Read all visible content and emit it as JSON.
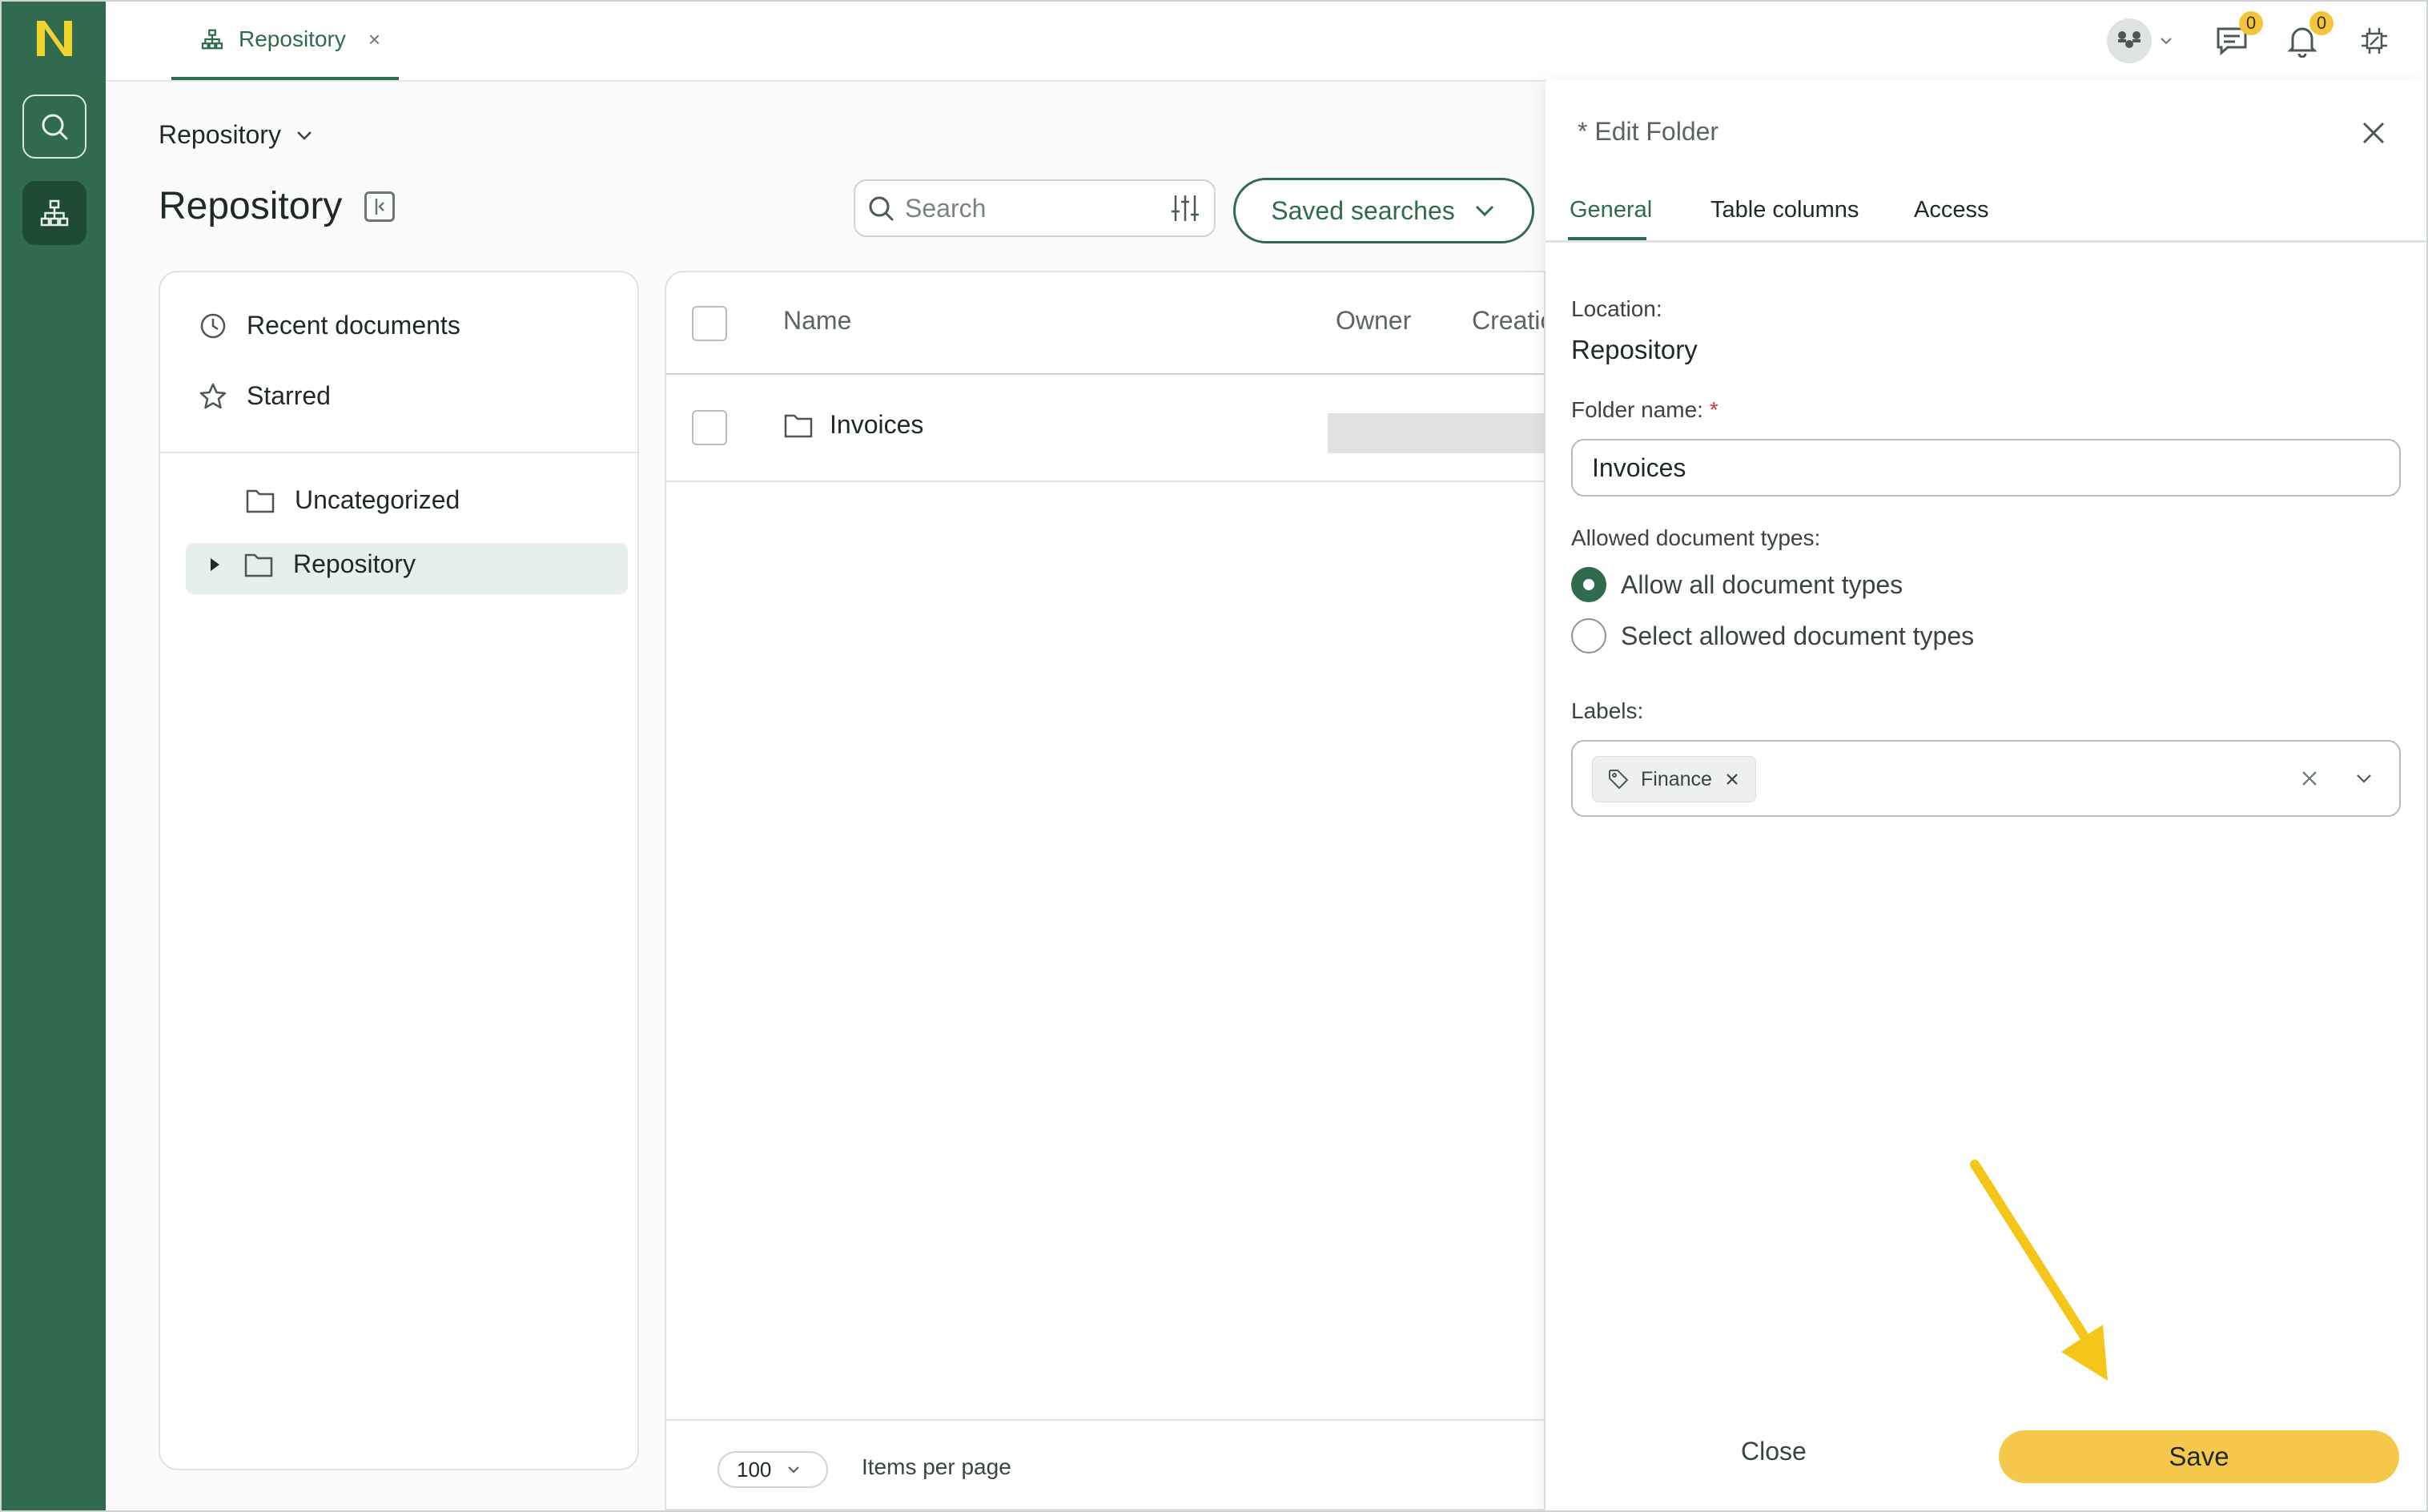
{
  "tabs": [
    {
      "label": "Repository",
      "close": "×"
    }
  ],
  "header": {
    "breadcrumb": "Repository",
    "title": "Repository",
    "search_placeholder": "Search",
    "saved_searches": "Saved searches",
    "messages_count": "0",
    "notifications_count": "0"
  },
  "nav": {
    "items": [
      {
        "label": "Recent documents",
        "icon": "clock-icon"
      },
      {
        "label": "Starred",
        "icon": "star-icon"
      }
    ],
    "tree": [
      {
        "label": "Uncategorized",
        "icon": "folder-icon",
        "selected": false
      },
      {
        "label": "Repository",
        "icon": "folder-icon",
        "selected": true,
        "expandable": true
      }
    ]
  },
  "table": {
    "columns": [
      "Name",
      "Owner",
      "Creatio"
    ],
    "rows": [
      {
        "name": "Invoices"
      }
    ],
    "per_page_value": "100",
    "per_page_label": "Items per page"
  },
  "edit_panel": {
    "title": "* Edit Folder",
    "tabs": [
      "General",
      "Table columns",
      "Access"
    ],
    "active_tab": "General",
    "location_label": "Location:",
    "location_value": "Repository",
    "folder_name_label": "Folder name:",
    "required_mark": "*",
    "folder_name_value": "Invoices",
    "doc_types_label": "Allowed document types:",
    "doc_type_options": [
      "Allow all document types",
      "Select allowed document types"
    ],
    "doc_type_selected": "Allow all document types",
    "labels_label": "Labels:",
    "labels": [
      "Finance"
    ],
    "close_label": "Close",
    "save_label": "Save"
  },
  "colors": {
    "brand_green": "#2f6b4c",
    "accent_yellow": "#f5c84c",
    "logo_yellow": "#f2d22c"
  }
}
